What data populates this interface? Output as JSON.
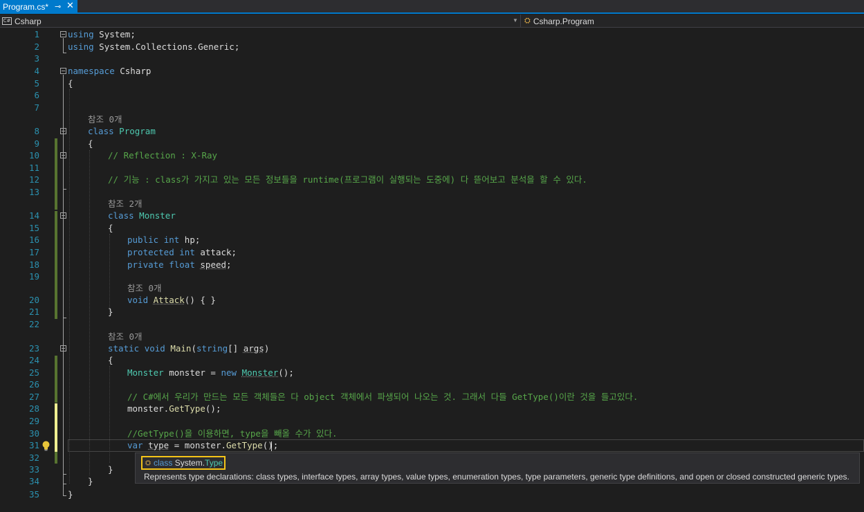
{
  "tab": {
    "title": "Program.cs*",
    "pin_icon": "pin-icon",
    "close_icon": "close-icon",
    "accent": "#007acc"
  },
  "navbar": {
    "project_icon": "csharp-project-icon",
    "project": "Csharp",
    "member_icon": "class-icon",
    "member": "Csharp.Program"
  },
  "gutter": {
    "numbers": [
      "1",
      "2",
      "3",
      "4",
      "5",
      "6",
      "7",
      "8",
      "9",
      "10",
      "11",
      "12",
      "13",
      "14",
      "15",
      "16",
      "17",
      "18",
      "19",
      "20",
      "21",
      "22",
      "23",
      "24",
      "25",
      "26",
      "27",
      "28",
      "29",
      "30",
      "31",
      "32",
      "33",
      "34",
      "35"
    ]
  },
  "codelens": {
    "program_refs": "참조 0개",
    "monster_refs": "참조 2개",
    "attack_refs": "참조 0개",
    "main_refs": "참조 0개"
  },
  "code": {
    "l1_kw": "using",
    "l1_rest": " System;",
    "l2_kw": "using",
    "l2_rest": " System.Collections.Generic;",
    "l4_kw": "namespace",
    "l4_rest": " Csharp",
    "l5": "{",
    "l8_kw": "class",
    "l8_type": "Program",
    "l9": "{",
    "l10": "// Reflection : X-Ray",
    "l12": "// 기능 : class가 가지고 있는 모든 정보들을 runtime(프로그램이 실행되는 도중에) 다 뜯어보고 분석을 할 수 있다.",
    "l14_kw": "class",
    "l14_type": "Monster",
    "l15": "{",
    "l16_kw1": "public",
    "l16_kw2": "int",
    "l16_rest": " hp;",
    "l17_kw1": "protected",
    "l17_kw2": "int",
    "l17_rest": " attack;",
    "l18_kw1": "private",
    "l18_kw2": "float",
    "l18_id": "speed",
    "l18_semi": ";",
    "l20_kw": "void",
    "l20_fn": "Attack",
    "l20_rest": "() { }",
    "l21": "}",
    "l23_kw1": "static",
    "l23_kw2": "void",
    "l23_fn": "Main",
    "l23_p1": "(",
    "l23_kw3": "string",
    "l23_p2": "[] ",
    "l23_arg": "args",
    "l23_p3": ")",
    "l24": "{",
    "l25_type": "Monster",
    "l25_mid": " monster = ",
    "l25_kw": "new",
    "l25_sp": " ",
    "l25_ctor": "Monster",
    "l25_end": "();",
    "l27": "// C#에서 우리가 만드는 모든 객체들은 다 object 객체에서 파생되어 나오는 것. 그래서 다들 GetType()이란 것을 들고있다.",
    "l28_a": "monster.",
    "l28_fn": "GetType",
    "l28_b": "();",
    "l30": "//GetType()을 이용하면, type을 빼올 수가 있다.",
    "l31_kw": "var",
    "l31_sp": " ",
    "l31_id": "type",
    "l31_mid": " = monster.",
    "l31_fn": "GetType",
    "l31_end": "();",
    "l33": "}",
    "l34": "}",
    "l35": "}"
  },
  "tooltip": {
    "icon": "class-icon",
    "sig_kw": "class",
    "sig_ns": "System.",
    "sig_type": "Type",
    "description": "Represents type declarations: class types, interface types, array types, value types, enumeration types, type parameters, generic type definitions, and open or closed constructed generic types."
  },
  "colors": {
    "keyword": "#569cd6",
    "type": "#4ec9b0",
    "comment": "#57a64a",
    "method": "#dcdcaa",
    "line_number": "#2b91af",
    "tooltip_highlight": "#f5c518"
  }
}
